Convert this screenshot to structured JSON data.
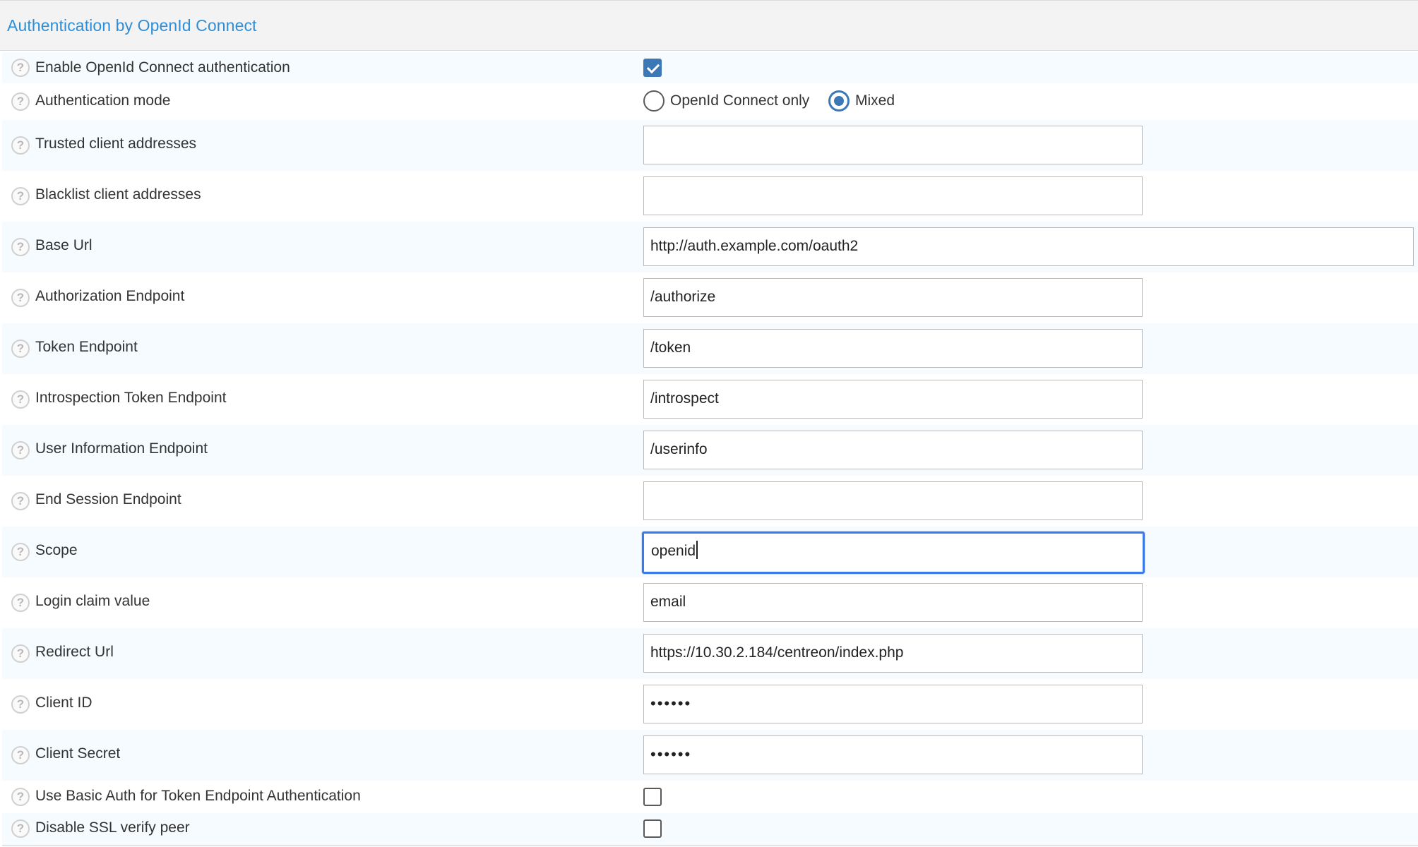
{
  "section": {
    "title": "Authentication by OpenId Connect"
  },
  "fields": {
    "enable": {
      "label": "Enable OpenId Connect authentication",
      "checked": true
    },
    "mode": {
      "label": "Authentication mode",
      "options": [
        "OpenId Connect only",
        "Mixed"
      ],
      "selected": "Mixed"
    },
    "trusted": {
      "label": "Trusted client addresses",
      "value": ""
    },
    "blacklist": {
      "label": "Blacklist client addresses",
      "value": ""
    },
    "base_url": {
      "label": "Base Url",
      "value": "http://auth.example.com/oauth2"
    },
    "authorization": {
      "label": "Authorization Endpoint",
      "value": "/authorize"
    },
    "token": {
      "label": "Token Endpoint",
      "value": "/token"
    },
    "introspection": {
      "label": "Introspection Token Endpoint",
      "value": "/introspect"
    },
    "userinfo": {
      "label": "User Information Endpoint",
      "value": "/userinfo"
    },
    "end_session": {
      "label": "End Session Endpoint",
      "value": ""
    },
    "scope": {
      "label": "Scope",
      "value": "openid",
      "focused": true
    },
    "login_claim": {
      "label": "Login claim value",
      "value": "email"
    },
    "redirect_url": {
      "label": "Redirect Url",
      "value": "https://10.30.2.184/centreon/index.php"
    },
    "client_id": {
      "label": "Client ID",
      "value": "••••••"
    },
    "client_secret": {
      "label": "Client Secret",
      "value": "••••••"
    },
    "basic_auth": {
      "label": "Use Basic Auth for Token Endpoint Authentication",
      "checked": false
    },
    "ssl_verify": {
      "label": "Disable SSL verify peer",
      "checked": false
    }
  },
  "icons": {
    "help": "?"
  },
  "colors": {
    "title": "#2f8ed7",
    "accent": "#3c78b5",
    "focus": "#3b7ae8",
    "row_alt": "#f5fbfe",
    "header_bg": "#f3f3f3"
  }
}
